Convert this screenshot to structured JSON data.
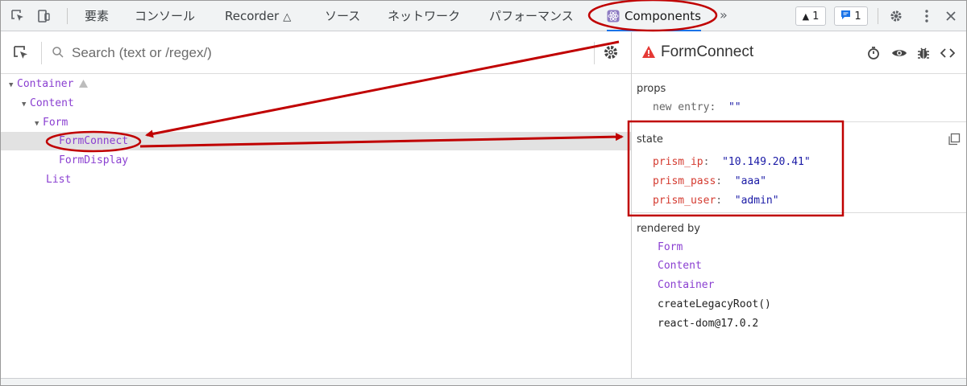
{
  "toolbar": {
    "tabs": [
      {
        "label": "要素"
      },
      {
        "label": "コンソール"
      },
      {
        "label": "Recorder"
      },
      {
        "label": "ソース"
      },
      {
        "label": "ネットワーク"
      },
      {
        "label": "パフォーマンス"
      },
      {
        "label": "Components"
      }
    ],
    "active_tab": "Components",
    "overflow_icon": "chevron-double-right-icon",
    "warnings_count": "1",
    "messages_count": "1"
  },
  "search": {
    "placeholder": "Search (text or /regex/)",
    "value": ""
  },
  "tree": [
    {
      "label": "Container",
      "depth": 0,
      "expanded": true,
      "warning": true
    },
    {
      "label": "Content",
      "depth": 1,
      "expanded": true
    },
    {
      "label": "Form",
      "depth": 2,
      "expanded": true
    },
    {
      "label": "FormConnect",
      "depth": 3,
      "selected": true
    },
    {
      "label": "FormDisplay",
      "depth": 3
    },
    {
      "label": "List",
      "depth": 2
    }
  ],
  "inspector": {
    "component_name": "FormConnect",
    "props_title": "props",
    "props": [
      {
        "key": "new entry",
        "value": "\"\""
      }
    ],
    "state_title": "state",
    "state": [
      {
        "key": "prism_ip",
        "value": "\"10.149.20.41\""
      },
      {
        "key": "prism_pass",
        "value": "\"aaa\""
      },
      {
        "key": "prism_user",
        "value": "\"admin\""
      }
    ],
    "rendered_by_title": "rendered by",
    "rendered_by": [
      {
        "label": "Form",
        "link": true
      },
      {
        "label": "Content",
        "link": true
      },
      {
        "label": "Container",
        "link": true
      },
      {
        "label": "createLegacyRoot()",
        "link": false
      },
      {
        "label": "react-dom@17.0.2",
        "link": false
      }
    ]
  },
  "colors": {
    "annotation": "#c00000",
    "component": "#8a3fd1",
    "state_key": "#d43a2f",
    "string_value": "#1a1aa6",
    "active_tab_underline": "#1a73e8"
  }
}
